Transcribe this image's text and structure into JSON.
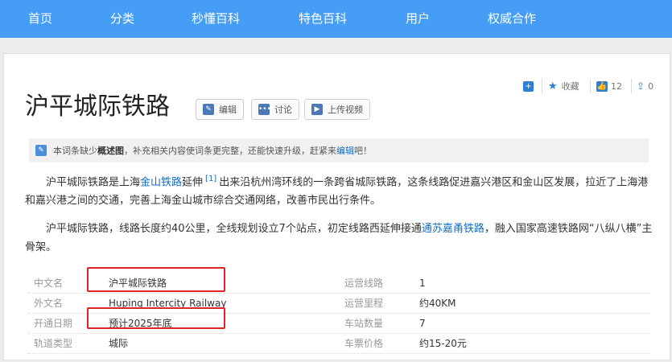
{
  "nav": {
    "items": [
      {
        "label": "首页"
      },
      {
        "label": "分类"
      },
      {
        "label": "秒懂百科"
      },
      {
        "label": "特色百科"
      },
      {
        "label": "用户"
      },
      {
        "label": "权威合作"
      }
    ]
  },
  "toolbar": {
    "favorite_label": "收藏",
    "like_count": "12",
    "share_count": "0"
  },
  "entry": {
    "title": "沪平城际铁路",
    "edit_label": "编辑",
    "discuss_label": "讨论",
    "upload_video_label": "上传视频"
  },
  "notice": {
    "prefix": "本词条缺少",
    "highlight": "概述图",
    "middle": "，补充相关内容使词条更完整，还能快速升级，赶紧来",
    "link": "编辑",
    "suffix": "吧！"
  },
  "summary": {
    "p1_a": "沪平城际铁路是上海",
    "p1_link": "金山铁路",
    "p1_b": "延伸",
    "p1_ref": "[1]",
    "p1_c": "出来沿杭州湾环线的一条跨省城际铁路，这条线路促进嘉兴港区和金山区发展，拉近了上海港和嘉兴港之间的交通，完善上海金山城市综合交通网络，改善市民出行条件。",
    "p2_a": "沪平城际铁路，线路长度约40公里，全线规划设立7个站点，初定线路西延伸接通",
    "p2_link": "通苏嘉甬铁路",
    "p2_b": "，融入国家高速铁路网“八纵八横”主骨架。"
  },
  "infobox": {
    "rows": [
      {
        "l1": "中文名",
        "v1": "沪平城际铁路",
        "l2": "运营线路",
        "v2": "1"
      },
      {
        "l1": "外文名",
        "v1": "Huping Intercity Railway",
        "l2": "运营里程",
        "v2": "约40KM"
      },
      {
        "l1": "开通日期",
        "v1": "预计2025年底",
        "l2": "车站数量",
        "v2": "7"
      },
      {
        "l1": "轨道类型",
        "v1": "城际",
        "l2": "车票价格",
        "v2": "约15-20元"
      }
    ]
  },
  "colors": {
    "nav_bg": "#459df5",
    "link": "#136ec2",
    "highlight_box": "#e02424"
  }
}
